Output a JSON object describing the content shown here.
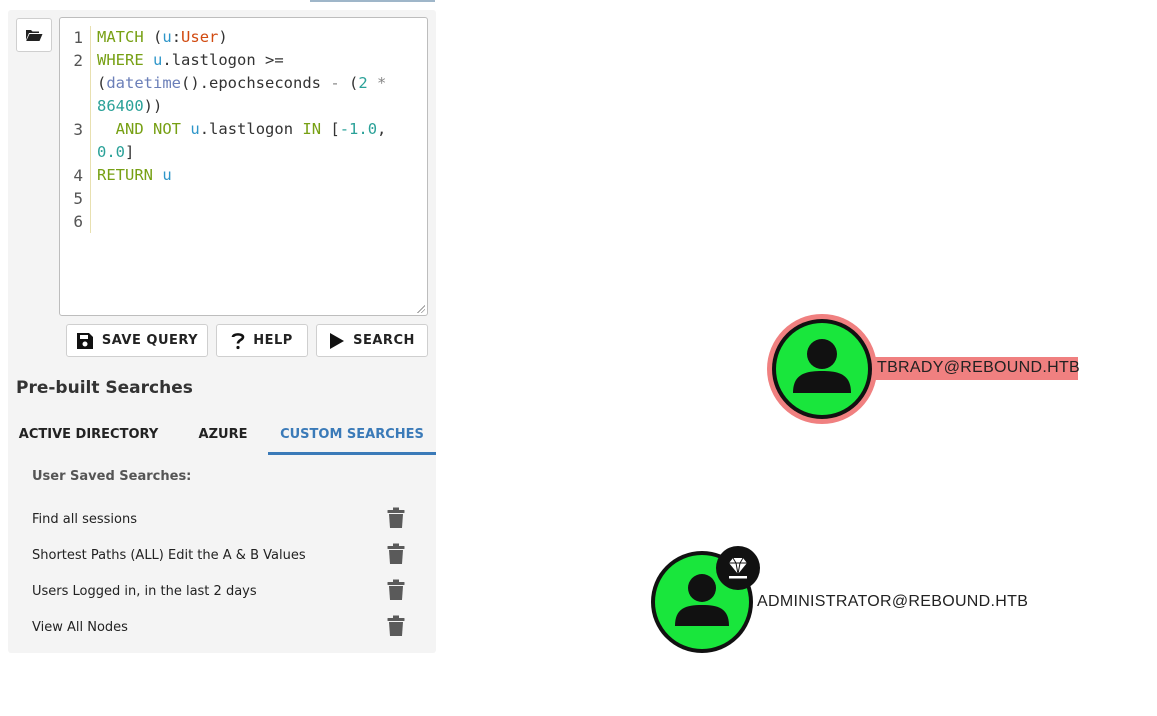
{
  "editor": {
    "line_numbers": [
      "1",
      "2",
      "3",
      "4",
      "5",
      "6"
    ]
  },
  "buttons": {
    "save_query": "SAVE QUERY",
    "help": "HELP",
    "search": "SEARCH"
  },
  "prebuilt": {
    "title": "Pre-built Searches",
    "tabs": [
      {
        "label": "ACTIVE DIRECTORY",
        "active": false
      },
      {
        "label": "AZURE",
        "active": false
      },
      {
        "label": "CUSTOM SEARCHES",
        "active": true
      }
    ],
    "saved_title": "User Saved Searches:",
    "items": [
      {
        "label": "Find all sessions"
      },
      {
        "label": "Shortest Paths (ALL) Edit the A & B Values"
      },
      {
        "label": "Users Logged in, in the last 2 days"
      },
      {
        "label": "View All Nodes"
      }
    ]
  },
  "graph": {
    "nodes": [
      {
        "label": "TBRADY@REBOUND.HTB",
        "highlighted": true,
        "icon": "user-icon"
      },
      {
        "label": "ADMINISTRATOR@REBOUND.HTB",
        "highlighted": false,
        "icon": "user-icon",
        "badge": "crown-gem-icon"
      }
    ]
  },
  "colors": {
    "node_fill": "#19e63c",
    "highlight": "#f08080",
    "accent": "#3a7ab8"
  }
}
